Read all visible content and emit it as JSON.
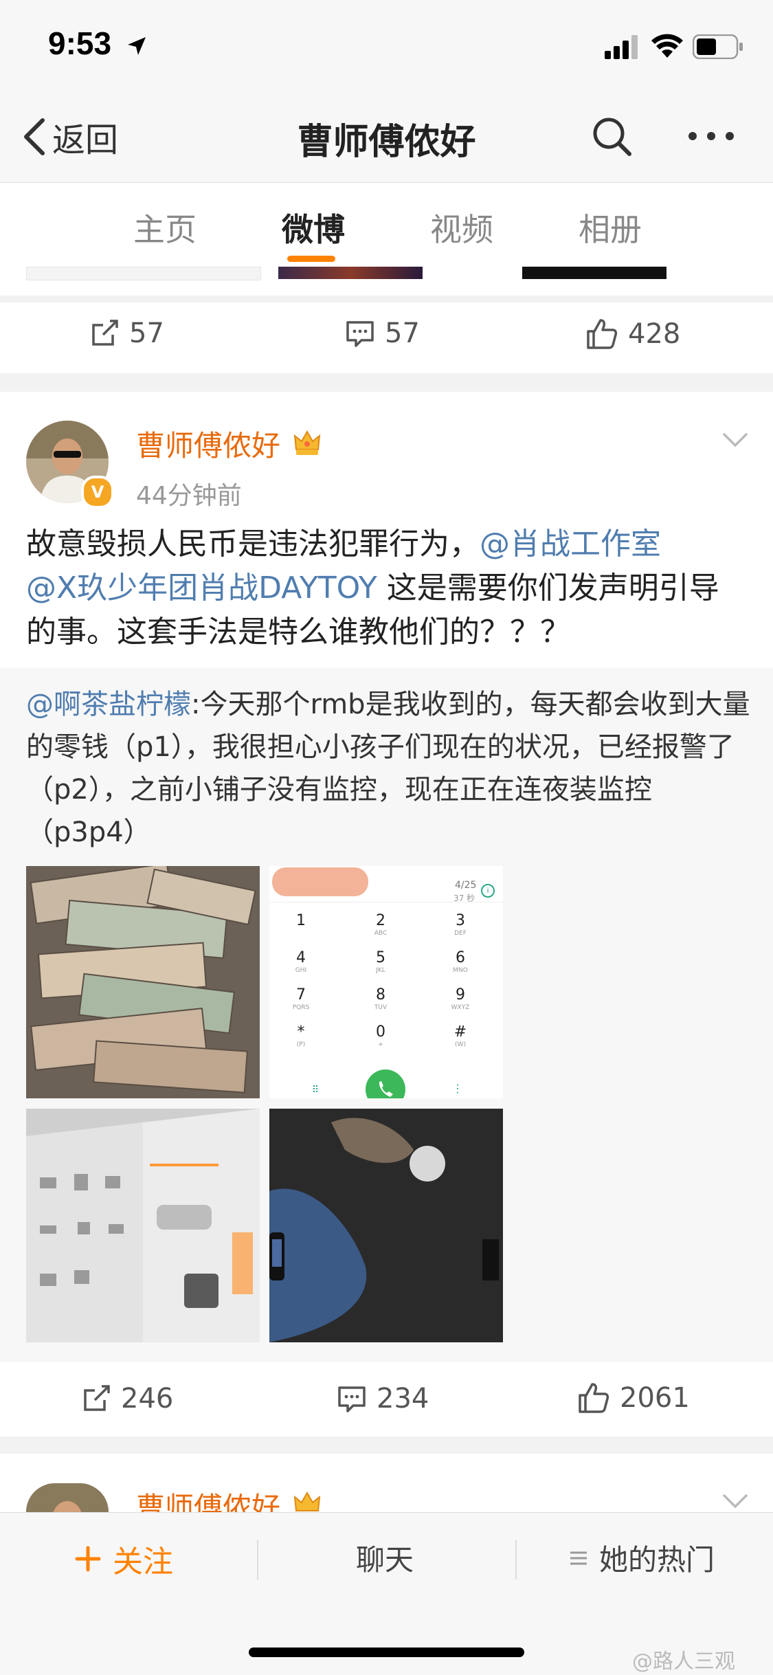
{
  "status_bar": {
    "time": "9:53"
  },
  "header": {
    "back_label": "返回",
    "title": "曹师傅侬好"
  },
  "tabs": [
    {
      "label": "主页"
    },
    {
      "label": "微博"
    },
    {
      "label": "视频"
    },
    {
      "label": "相册"
    }
  ],
  "post_top_actions": {
    "repost_count": "57",
    "comment_count": "57",
    "like_count": "428"
  },
  "post": {
    "author": "曹师傅侬好",
    "time": "44分钟前",
    "text_1": "故意毁损人民币是违法犯罪行为，",
    "mention_1": "@肖战工作室",
    "mention_2": "@X玖少年团肖战DAYTOY",
    "text_2": " 这是需要你们发声明引导的事。这套手法是特么谁教他们的？？？",
    "repost": {
      "mention": "@啊茶盐柠檬",
      "text": ":今天那个rmb是我收到的，每天都会收到大量的零钱（p1），我很担心小孩子们现在的状况，已经报警了（p2），之前小铺子没有监控，现在正在连夜装监控（p3p4）"
    },
    "dialer": {
      "date": "4/25",
      "duration": "37 秒",
      "keys": [
        {
          "num": "1",
          "sub": "",
          "aria": ""
        },
        {
          "num": "2",
          "sub": "ABC"
        },
        {
          "num": "3",
          "sub": "DEF"
        },
        {
          "num": "4",
          "sub": "GHI"
        },
        {
          "num": "5",
          "sub": "JKL"
        },
        {
          "num": "6",
          "sub": "MNO"
        },
        {
          "num": "7",
          "sub": "PQRS"
        },
        {
          "num": "8",
          "sub": "TUV"
        },
        {
          "num": "9",
          "sub": "WXYZ"
        },
        {
          "num": "*",
          "sub": "(P)"
        },
        {
          "num": "0",
          "sub": "+"
        },
        {
          "num": "#",
          "sub": "(W)"
        }
      ]
    },
    "actions": {
      "repost_count": "246",
      "comment_count": "234",
      "like_count": "2061"
    }
  },
  "next_post": {
    "author": "曹师傅侬好"
  },
  "bottom_bar": {
    "follow_label": "关注",
    "chat_label": "聊天",
    "hot_label": "她的热门"
  },
  "watermark": "@路人三观",
  "colors": {
    "accent": "#ff8200",
    "link": "#507daf",
    "username": "#e86b0d"
  }
}
